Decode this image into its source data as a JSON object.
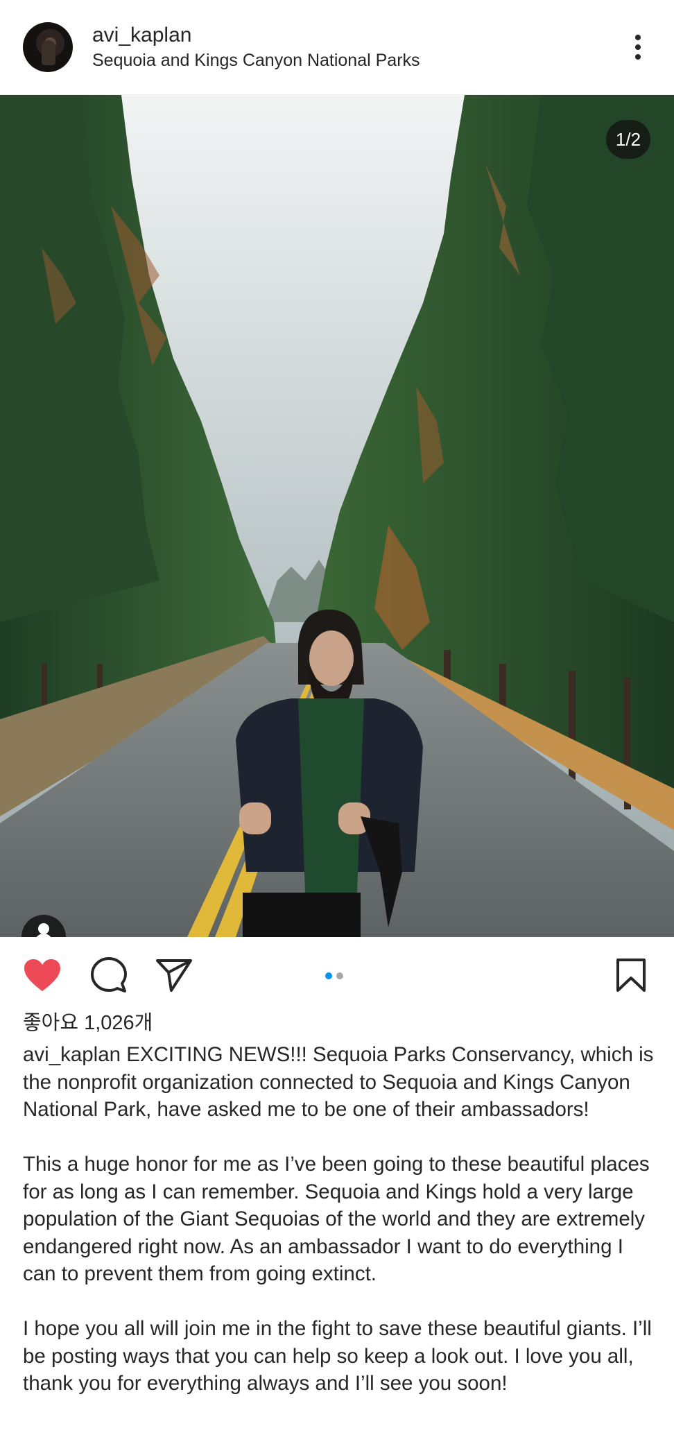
{
  "post": {
    "username": "avi_kaplan",
    "location": "Sequoia and Kings Canyon National Parks",
    "photo_counter": "1/2",
    "carousel": {
      "total": 2,
      "current": 1
    },
    "likes": "좋아요 1,026개",
    "caption_paragraphs": [
      "EXCITING NEWS!!! Sequoia Parks Conservancy, which is the nonprofit organization connected to Sequoia and Kings Canyon National Park, have asked me to be one of their ambassadors!",
      "This a huge honor for me as I’ve been going to these beautiful places for as long as I can remember. Sequoia and Kings hold a very large population of the Giant Sequoias of the world and they are extremely endangered right now. As an ambassador I want to do everything I can to prevent them from going extinct.",
      "I hope you all will join me in the fight to save these beautiful giants. I’ll be posting ways that you can help so keep a look out. I love you all, thank you for everything always and I’ll see you soon!"
    ],
    "liked": true
  },
  "icons": {
    "like": "heart-icon",
    "comment": "comment-bubble-icon",
    "share": "paper-plane-icon",
    "save": "bookmark-icon",
    "more": "more-vertical-icon",
    "tag": "user-tag-icon"
  },
  "colors": {
    "text": "#262626",
    "like_red": "#ed4956",
    "carousel_active": "#0095f6",
    "carousel_inactive": "#a8a8a8"
  }
}
